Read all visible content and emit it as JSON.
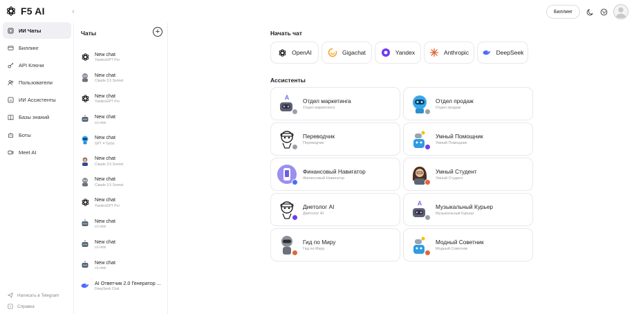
{
  "app": {
    "name": "F5 AI"
  },
  "sidebar": {
    "items": [
      {
        "label": "ИИ Чаты",
        "icon": "chat-icon",
        "active": true
      },
      {
        "label": "Биллинг",
        "icon": "wallet-icon"
      },
      {
        "label": "API Ключи",
        "icon": "key-icon"
      },
      {
        "label": "Пользователи",
        "icon": "users-icon"
      },
      {
        "label": "ИИ Ассистенты",
        "icon": "ai-icon"
      },
      {
        "label": "Базы знаний",
        "icon": "book-icon"
      },
      {
        "label": "Боты",
        "icon": "bot-icon"
      },
      {
        "label": "Meet AI",
        "icon": "video-icon"
      }
    ],
    "footer": {
      "telegram": "Написать в Telegram",
      "help": "Справка"
    }
  },
  "chats": {
    "title": "Чаты",
    "add_label": "+",
    "items": [
      {
        "title": "New chat",
        "model": "YandexGPT Pro",
        "icon": "openai"
      },
      {
        "title": "New chat",
        "model": "Claude 3.5 Sonnet",
        "icon": "robot-gray"
      },
      {
        "title": "New chat",
        "model": "YandexGPT Pro",
        "icon": "openai"
      },
      {
        "title": "New chat",
        "model": "o1-mini",
        "icon": "robot-small"
      },
      {
        "title": "New chat",
        "model": "GPT 4 Turbo",
        "icon": "robot-blue"
      },
      {
        "title": "New chat",
        "model": "Claude 3.5 Sonnet",
        "icon": "person"
      },
      {
        "title": "New chat",
        "model": "Claude 3.5 Sonnet",
        "icon": "robot-gray"
      },
      {
        "title": "New chat",
        "model": "YandexGPT Pro",
        "icon": "openai"
      },
      {
        "title": "New chat",
        "model": "o1-mini",
        "icon": "robot-small"
      },
      {
        "title": "New chat",
        "model": "o1-mini",
        "icon": "robot-small"
      },
      {
        "title": "New chat",
        "model": "o1-mini",
        "icon": "robot-small"
      },
      {
        "title": "AI Ответчик 2.0 Генератор ...",
        "model": "DeepSeek Chat",
        "icon": "deepseek"
      }
    ]
  },
  "header": {
    "billing_button": "Биллинг"
  },
  "start_chat": {
    "title": "Начать чат",
    "providers": [
      {
        "label": "OpenAI",
        "icon": "openai-icon",
        "color": "#111111"
      },
      {
        "label": "Gigachat",
        "icon": "gigachat-icon",
        "color": "#f5a623"
      },
      {
        "label": "Yandex",
        "icon": "yandex-icon",
        "color": "#6c3cf0"
      },
      {
        "label": "Anthropic",
        "icon": "anthropic-icon",
        "color": "#e0663a"
      },
      {
        "label": "DeepSeek",
        "icon": "deepseek-icon",
        "color": "#4d6bfe"
      }
    ]
  },
  "assistants": {
    "title": "Ассистенты",
    "items": [
      {
        "name": "Отдел маркетинга",
        "desc": "Отдел маркетинга",
        "avatar": "robot-purple",
        "badge": "#9aa0a6"
      },
      {
        "name": "Отдел продаж",
        "desc": "Отдел продаж",
        "avatar": "robot-blue",
        "badge": "#9aa0a6"
      },
      {
        "name": "Переводчик",
        "desc": "Переводчик",
        "avatar": "robot-outline",
        "badge": "#9aa0a6"
      },
      {
        "name": "Умный Помощник",
        "desc": "Умный Помощник",
        "avatar": "robot-small",
        "badge": "#6c3cf0"
      },
      {
        "name": "Финансовый Навигатор",
        "desc": "Финансовый Навигатор",
        "avatar": "phone-purple",
        "badge": "#4d6bfe"
      },
      {
        "name": "Умный Студент",
        "desc": "Умный Студент",
        "avatar": "person-girl",
        "badge": "#e0663a"
      },
      {
        "name": "Диетолог AI",
        "desc": "Диетолог AI",
        "avatar": "robot-outline",
        "badge": "#6c3cf0"
      },
      {
        "name": "Музыкальный Курьер",
        "desc": "Музыкальный Курьер",
        "avatar": "robot-purple",
        "badge": "#9aa0a6"
      },
      {
        "name": "Гид по Миру",
        "desc": "Гид по Миру",
        "avatar": "robot-gray",
        "badge": "#e0663a"
      },
      {
        "name": "Модный Советник",
        "desc": "Модный Советник",
        "avatar": "robot-small",
        "badge": "#e0663a"
      }
    ]
  }
}
